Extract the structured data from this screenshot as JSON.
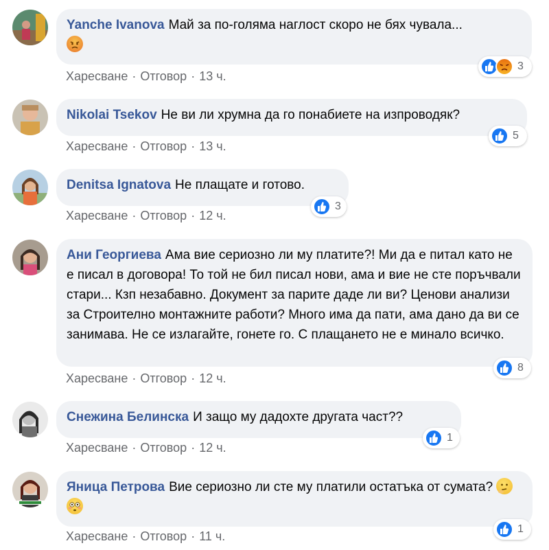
{
  "comments": [
    {
      "author": "Yanche Ivanova",
      "text": "Май за по-голяма наглост скоро не бях чувала...",
      "emoji": "angry-face",
      "actions": {
        "like": "Харесване",
        "reply": "Отговор",
        "time": "13 ч."
      },
      "reactions": {
        "types": [
          "like",
          "angry"
        ],
        "count": "3"
      }
    },
    {
      "author": "Nikolai Tsekov",
      "text": "Не ви ли хрумна да го понабиете на изпроводяк?",
      "actions": {
        "like": "Харесване",
        "reply": "Отговор",
        "time": "13 ч."
      },
      "reactions": {
        "types": [
          "like"
        ],
        "count": "5"
      }
    },
    {
      "author": "Denitsa Ignatova",
      "text": "Не плащате и готово.",
      "actions": {
        "like": "Харесване",
        "reply": "Отговор",
        "time": "12 ч."
      },
      "reactions": {
        "types": [
          "like"
        ],
        "count": "3"
      }
    },
    {
      "author": "Ани Георгиева",
      "text": "Ама вие сериозно ли му платите?! Ми да е питал като не е писал в договора! То той не бил писал нови, ама и вие не сте поръчвали стари... Кзп незабавно. Документ за парите даде ли ви? Ценови анализи за Строително монтажните работи? Много има да пати, ама дано да ви се занимава. Не се излагайте, гонете го. С плащането не е минало всичко.",
      "actions": {
        "like": "Харесване",
        "reply": "Отговор",
        "time": "12 ч."
      },
      "reactions": {
        "types": [
          "like"
        ],
        "count": "8"
      }
    },
    {
      "author": "Снежина Белинска",
      "text": "И защо му дадохте другата част??",
      "actions": {
        "like": "Харесване",
        "reply": "Отговор",
        "time": "12 ч."
      },
      "reactions": {
        "types": [
          "like"
        ],
        "count": "1"
      }
    },
    {
      "author": "Яница Петрова",
      "text": "Вие сериозно ли сте му платили остатъка от сумата?",
      "emoji": "thinking-face, flushed-face",
      "actions": {
        "like": "Харесване",
        "reply": "Отговор",
        "time": "11 ч."
      },
      "reactions": {
        "types": [
          "like"
        ],
        "count": "1"
      }
    }
  ],
  "colors": {
    "bubble": "#f0f2f5",
    "author": "#385898",
    "meta": "#65676b",
    "like": "#1877f2"
  }
}
